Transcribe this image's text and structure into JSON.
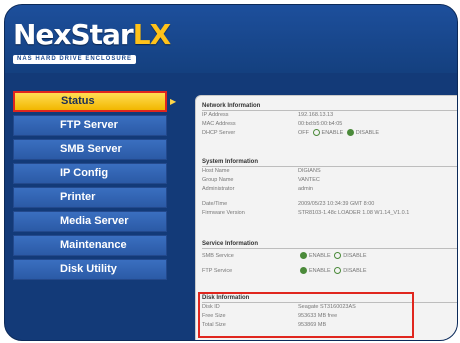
{
  "logo": {
    "main": "NexStar",
    "accent": "LX",
    "tagline": "NAS HARD DRIVE ENCLOSURE"
  },
  "nav": {
    "items": [
      {
        "label": "Status"
      },
      {
        "label": "FTP Server"
      },
      {
        "label": "SMB Server"
      },
      {
        "label": "IP Config"
      },
      {
        "label": "Printer"
      },
      {
        "label": "Media Server"
      },
      {
        "label": "Maintenance"
      },
      {
        "label": "Disk Utility"
      }
    ],
    "active_index": 0
  },
  "network": {
    "title": "Network Information",
    "ip_label": "IP Address",
    "ip_value": "192.168.13.13",
    "mac_label": "MAC Address",
    "mac_value": "00:bd:b5:00:b4:05",
    "dhcp_label": "DHCP Server",
    "dhcp_value": "OFF",
    "enable": "ENABLE",
    "disable": "DISABLE"
  },
  "system": {
    "title": "System Information",
    "host_label": "Host Name",
    "host_value": "DIGIANS",
    "group_label": "Group Name",
    "group_value": "VANTEC",
    "admin_label": "Administrator",
    "admin_value": "admin",
    "date_label": "Date/Time",
    "date_value": "2009/05/23 10:34:39 GMT 8:00",
    "fw_label": "Firmware Version",
    "fw_value": "STR8103-1.48c LOADER 1.08 W1.14_V1.0.1"
  },
  "service": {
    "title": "Service Information",
    "smb_label": "SMB Service",
    "ftp_label": "FTP Service",
    "enable": "ENABLE",
    "disable": "DISABLE"
  },
  "disk": {
    "title": "Disk Information",
    "id_label": "Disk ID",
    "id_value": "Seagate ST3160023AS",
    "free_label": "Free Size",
    "free_value": "953633 MB free",
    "total_label": "Total Size",
    "total_value": "953869 MB"
  },
  "colors": {
    "brand_blue": "#133a78",
    "accent_yellow": "#ffc21a",
    "highlight_red": "#e0261e"
  }
}
